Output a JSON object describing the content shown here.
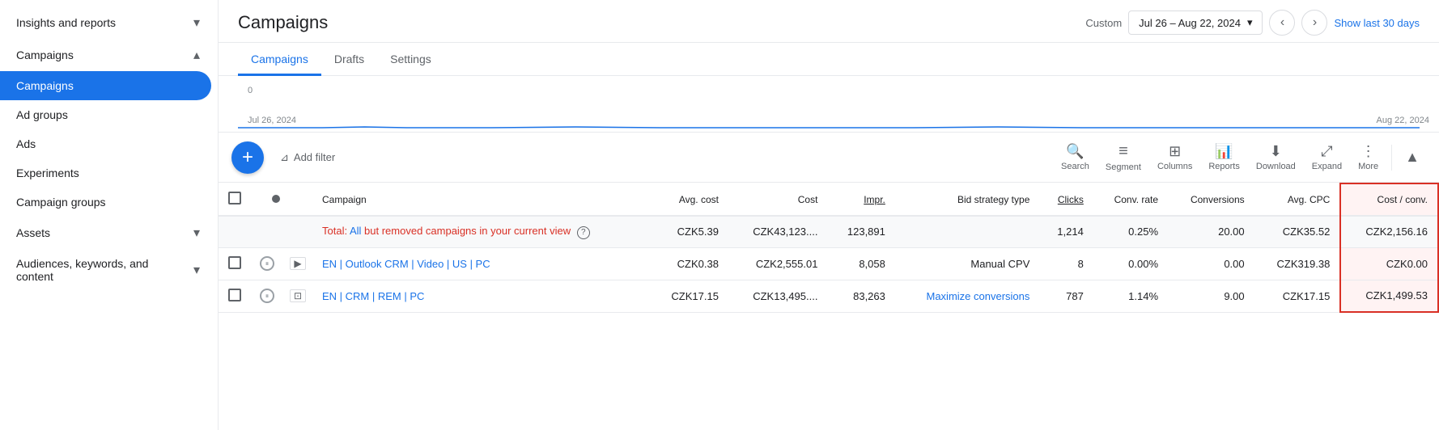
{
  "sidebar": {
    "items": [
      {
        "id": "insights-and-reports",
        "label": "Insights and reports",
        "arrow": "▾",
        "expanded": true
      },
      {
        "id": "campaigns",
        "label": "Campaigns",
        "arrow": "▴",
        "expanded": true
      },
      {
        "id": "campaigns-active",
        "label": "Campaigns",
        "active": true
      },
      {
        "id": "ad-groups",
        "label": "Ad groups"
      },
      {
        "id": "ads",
        "label": "Ads"
      },
      {
        "id": "experiments",
        "label": "Experiments"
      },
      {
        "id": "campaign-groups",
        "label": "Campaign groups"
      },
      {
        "id": "assets",
        "label": "Assets",
        "arrow": "▾"
      },
      {
        "id": "audiences-keywords",
        "label": "Audiences, keywords, and content",
        "arrow": "▾"
      }
    ]
  },
  "header": {
    "title": "Campaigns",
    "custom_label": "Custom",
    "date_range": "Jul 26 – Aug 22, 2024",
    "show_last_label": "Show last 30 days"
  },
  "tabs": [
    {
      "id": "campaigns-tab",
      "label": "Campaigns",
      "active": true
    },
    {
      "id": "drafts-tab",
      "label": "Drafts"
    },
    {
      "id": "settings-tab",
      "label": "Settings"
    }
  ],
  "chart": {
    "zero_label": "0",
    "date_left": "Jul 26, 2024",
    "date_right": "Aug 22, 2024"
  },
  "toolbar": {
    "add_button": "+",
    "filter_label": "Add filter",
    "actions": [
      {
        "id": "search",
        "icon": "🔍",
        "label": "Search"
      },
      {
        "id": "segment",
        "icon": "≡",
        "label": "Segment"
      },
      {
        "id": "columns",
        "icon": "⊞",
        "label": "Columns"
      },
      {
        "id": "reports",
        "icon": "📊",
        "label": "Reports"
      },
      {
        "id": "download",
        "icon": "⬇",
        "label": "Download"
      },
      {
        "id": "expand",
        "icon": "⤢",
        "label": "Expand"
      },
      {
        "id": "more",
        "icon": "⋮",
        "label": "More"
      }
    ],
    "collapse_icon": "▲"
  },
  "table": {
    "columns": [
      {
        "id": "check",
        "label": ""
      },
      {
        "id": "status",
        "label": ""
      },
      {
        "id": "type-icon",
        "label": ""
      },
      {
        "id": "name",
        "label": "Campaign"
      },
      {
        "id": "avg-cost",
        "label": "Avg. cost"
      },
      {
        "id": "cost",
        "label": "Cost"
      },
      {
        "id": "impr",
        "label": "Impr.",
        "underline": true
      },
      {
        "id": "bid-strategy",
        "label": "Bid strategy type"
      },
      {
        "id": "clicks",
        "label": "Clicks",
        "underline": true
      },
      {
        "id": "conv-rate",
        "label": "Conv. rate"
      },
      {
        "id": "conversions",
        "label": "Conversions"
      },
      {
        "id": "avg-cpc",
        "label": "Avg. CPC"
      },
      {
        "id": "cost-conv",
        "label": "Cost / conv.",
        "highlighted": true
      }
    ],
    "total_row": {
      "label_prefix": "Total: ",
      "label_link": "All",
      "label_suffix": " but removed campaigns in your current view",
      "avg_cost": "CZK5.39",
      "cost": "CZK43,123....",
      "impr": "123,891",
      "bid_strategy": "",
      "clicks": "1,214",
      "conv_rate": "0.25%",
      "conversions": "20.00",
      "avg_cpc": "CZK35.52",
      "cost_conv": "CZK2,156.16"
    },
    "rows": [
      {
        "id": "row-1",
        "status": "paused",
        "type": "video",
        "name": "EN | Outlook CRM | Video | US | PC",
        "avg_cost": "CZK0.38",
        "cost": "CZK2,555.01",
        "impr": "8,058",
        "bid_strategy": "Manual CPV",
        "bid_strategy_link": false,
        "clicks": "8",
        "conv_rate": "0.00%",
        "conversions": "0.00",
        "avg_cpc": "CZK319.38",
        "cost_conv": "CZK0.00"
      },
      {
        "id": "row-2",
        "status": "paused",
        "type": "display",
        "name": "EN | CRM | REM | PC",
        "avg_cost": "CZK17.15",
        "cost": "CZK13,495....",
        "impr": "83,263",
        "bid_strategy": "Maximize conversions",
        "bid_strategy_link": true,
        "clicks": "787",
        "conv_rate": "1.14%",
        "conversions": "9.00",
        "avg_cpc": "CZK17.15",
        "cost_conv": "CZK1,499.53"
      }
    ]
  }
}
